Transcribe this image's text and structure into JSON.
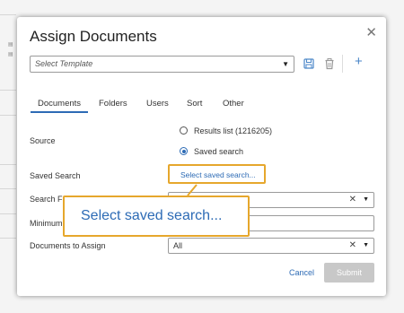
{
  "dialog": {
    "title": "Assign Documents",
    "template_placeholder": "Select Template"
  },
  "tabs": [
    "Documents",
    "Folders",
    "Users",
    "Sort",
    "Other"
  ],
  "source": {
    "label": "Source",
    "options": [
      {
        "label": "Results list (1216205)",
        "checked": false
      },
      {
        "label": "Saved search",
        "checked": true
      }
    ]
  },
  "saved_search": {
    "label": "Saved Search",
    "link": "Select saved search..."
  },
  "search_from": {
    "label": "Search Fr"
  },
  "minimum": {
    "label": "Minimum"
  },
  "documents_to_assign": {
    "label": "Documents to Assign",
    "value": "All"
  },
  "callout": {
    "text": "Select saved search..."
  },
  "buttons": {
    "cancel": "Cancel",
    "submit": "Submit"
  },
  "colors": {
    "accent": "#2d6bb5",
    "highlight": "#e6a72c",
    "submit_disabled": "#c8c8c8"
  }
}
